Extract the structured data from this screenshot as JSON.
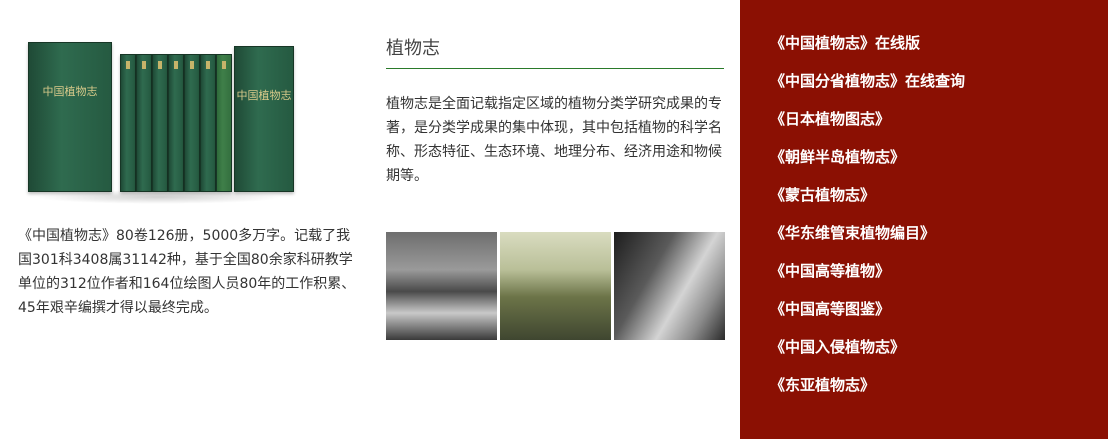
{
  "left": {
    "book_cover_title": "中国植物志",
    "description": "《中国植物志》80卷126册，5000多万字。记载了我国301科3408属31142种，基于全国80余家科研教学单位的312位作者和164位绘图人员80年的工作积累、45年艰辛编撰才得以最终完成。"
  },
  "middle": {
    "title": "植物志",
    "description": "植物志是全面记载指定区域的植物分类学研究成果的专著，是分类学成果的集中体现，其中包括植物的科学名称、形态特征、生态环境、地理分布、经济用途和物候期等。"
  },
  "links": [
    {
      "label": "《中国植物志》在线版"
    },
    {
      "label": "《中国分省植物志》在线查询"
    },
    {
      "label": "《日本植物图志》"
    },
    {
      "label": "《朝鲜半岛植物志》"
    },
    {
      "label": "《蒙古植物志》"
    },
    {
      "label": "《华东维管束植物编目》"
    },
    {
      "label": "《中国高等植物》"
    },
    {
      "label": "《中国高等图鉴》"
    },
    {
      "label": "《中国入侵植物志》"
    },
    {
      "label": "《东亚植物志》"
    }
  ],
  "colors": {
    "panel_bg": "#8b1003",
    "rule": "#2a7a2a",
    "book_green": "#2f6b4f"
  }
}
